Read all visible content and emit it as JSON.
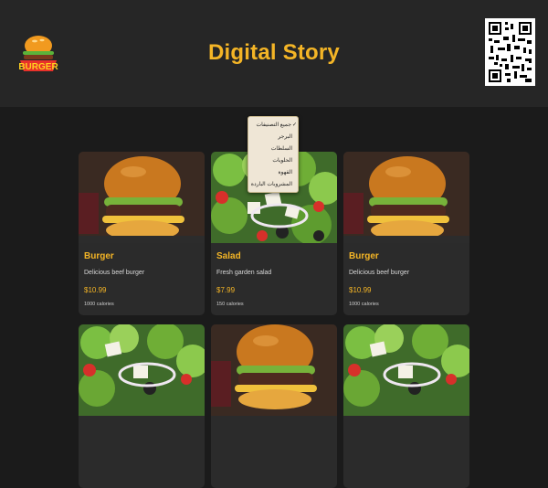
{
  "header": {
    "title": "Digital Story",
    "logo_text": "BURGER"
  },
  "category_menu": {
    "items": [
      {
        "label": "جميع التصنيفات",
        "selected": true
      },
      {
        "label": "البرجر"
      },
      {
        "label": "السلطات"
      },
      {
        "label": "الحلويات"
      },
      {
        "label": "القهوة"
      },
      {
        "label": "المشروبات الباردة"
      }
    ]
  },
  "menu_items": [
    {
      "name": "Burger",
      "description": "Delicious beef burger",
      "price": "$10.99",
      "calories": "1000 calories",
      "image": "burger"
    },
    {
      "name": "Salad",
      "description": "Fresh garden salad",
      "price": "$7.99",
      "calories": "150 calories",
      "image": "salad"
    },
    {
      "name": "Burger",
      "description": "Delicious beef burger",
      "price": "$10.99",
      "calories": "1000 calories",
      "image": "burger"
    },
    {
      "image": "salad"
    },
    {
      "image": "burger"
    },
    {
      "image": "salad"
    }
  ],
  "colors": {
    "accent": "#f4b526",
    "background": "#1b1b1b",
    "header": "#262626",
    "card": "#2b2b2b"
  }
}
